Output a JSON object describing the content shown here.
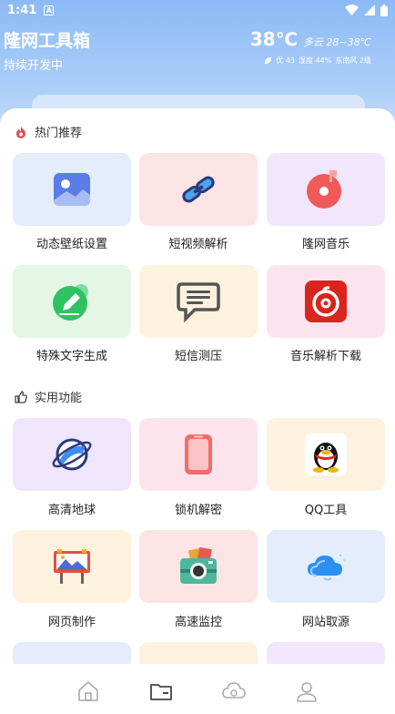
{
  "status": {
    "time": "1:41",
    "notif": "A"
  },
  "header": {
    "title": "隆网工具箱",
    "subtitle": "持续开发中"
  },
  "weather": {
    "temp": "38℃",
    "condition": "多云 28~38℃",
    "air": "优 43",
    "humidity": "湿度 44%",
    "wind": "东南风 2级"
  },
  "sections": [
    {
      "title": "热门推荐"
    },
    {
      "title": "实用功能"
    }
  ],
  "hot": [
    {
      "label": "动态壁纸设置",
      "bg": "#e3edfb"
    },
    {
      "label": "短视频解析",
      "bg": "#fde4e4"
    },
    {
      "label": "隆网音乐",
      "bg": "#f1e6fb"
    },
    {
      "label": "特殊文字生成",
      "bg": "#e4f6e4"
    },
    {
      "label": "短信测压",
      "bg": "#fcf2dd"
    },
    {
      "label": "音乐解析下载",
      "bg": "#fde3ee"
    }
  ],
  "util": [
    {
      "label": "高清地球",
      "bg": "#efe6fb"
    },
    {
      "label": "锁机解密",
      "bg": "#fde4ec"
    },
    {
      "label": "QQ工具",
      "bg": "#fcf2dd"
    },
    {
      "label": "网页制作",
      "bg": "#fcf2dd"
    },
    {
      "label": "高速监控",
      "bg": "#fde4e4"
    },
    {
      "label": "网站取源",
      "bg": "#e3edfb"
    }
  ],
  "nav": [
    "home",
    "folder",
    "cloud",
    "user"
  ]
}
